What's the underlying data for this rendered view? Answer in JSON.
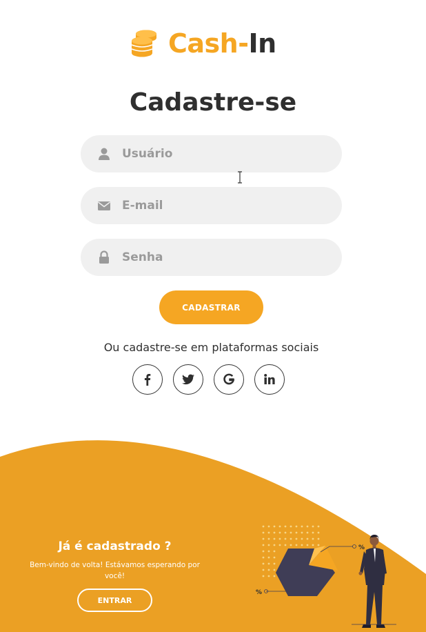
{
  "brand": {
    "name_part1": "Cash-",
    "name_part2": "In",
    "accent": "#f5a623",
    "dark": "#2f2f2f",
    "icon": "coins-icon"
  },
  "signup": {
    "title": "Cadastre-se",
    "fields": {
      "username": {
        "placeholder": "Usuário",
        "value": "",
        "icon": "user-icon"
      },
      "email": {
        "placeholder": "E-mail",
        "value": "",
        "icon": "envelope-icon"
      },
      "password": {
        "placeholder": "Senha",
        "value": "",
        "icon": "lock-icon"
      }
    },
    "submit_label": "CADASTRAR",
    "social_text": "Ou cadastre-se em plataformas sociais",
    "socials": [
      "facebook-icon",
      "twitter-icon",
      "google-icon",
      "linkedin-icon"
    ]
  },
  "login_panel": {
    "title": "Já é cadastrado ?",
    "subtitle": "Bem-vindo de volta! Estávamos esperando por você!",
    "button_label": "ENTRAR",
    "background": "#eba024",
    "illustration_labels": [
      "%",
      "%"
    ]
  }
}
